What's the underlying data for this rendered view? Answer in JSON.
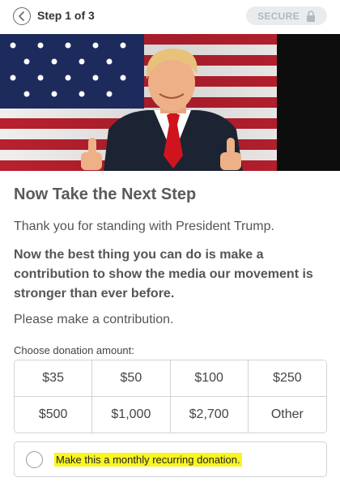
{
  "header": {
    "step_label": "Step 1 of 3",
    "secure_label": "SECURE",
    "back_icon": "chevron-left-icon",
    "lock_icon": "lock-icon"
  },
  "hero": {
    "image": "photo of speaker in dark suit and red tie giving thumbs up in front of American flag"
  },
  "main": {
    "title": "Now Take the Next Step",
    "thanks": "Thank you for standing with President Trump.",
    "pitch": "Now the best thing you can do is make a contribution to show the media our movement is stronger than ever before.",
    "please": "Please make a contribution."
  },
  "donation": {
    "choose_label": "Choose donation amount:",
    "amounts": [
      "$35",
      "$50",
      "$100",
      "$250",
      "$500",
      "$1,000",
      "$2,700",
      "Other"
    ]
  },
  "recurring": {
    "label": "Make this a monthly recurring donation.",
    "checked": false,
    "highlight_color": "#f8f520"
  }
}
